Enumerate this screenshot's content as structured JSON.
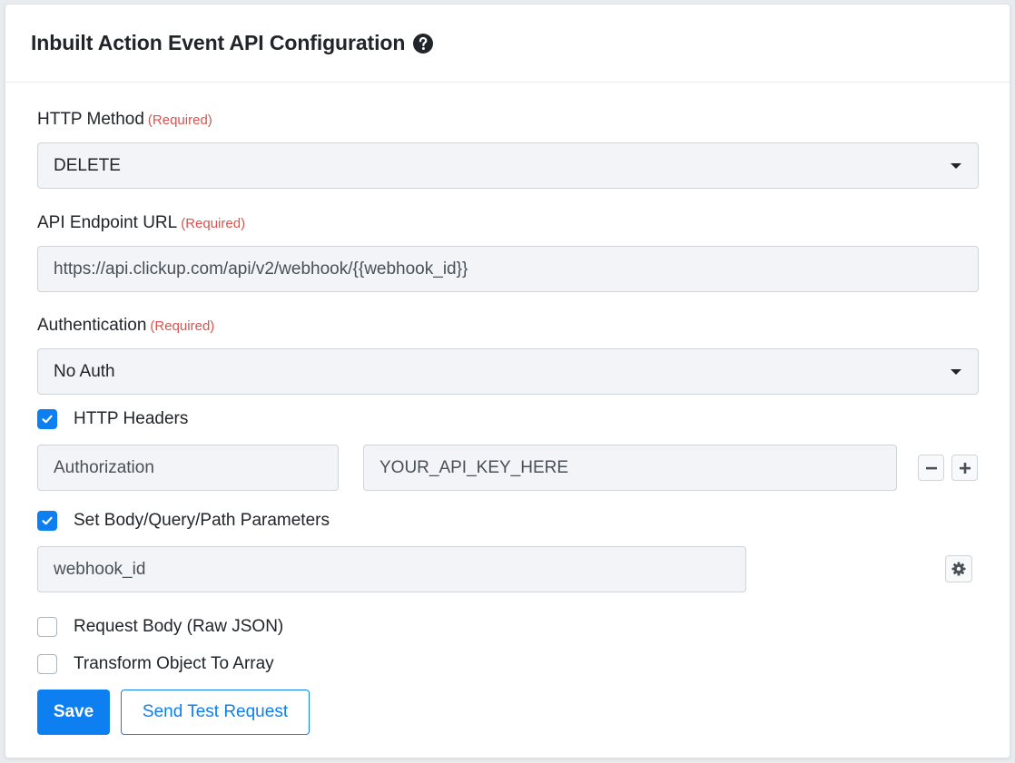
{
  "header": {
    "title": "Inbuilt Action Event API Configuration",
    "help_icon": "question-circle-icon"
  },
  "fields": {
    "http_method": {
      "label": "HTTP Method",
      "required": "(Required)",
      "value": "DELETE"
    },
    "endpoint": {
      "label": "API Endpoint URL",
      "required": "(Required)",
      "value": "https://api.clickup.com/api/v2/webhook/{{webhook_id}}"
    },
    "authentication": {
      "label": "Authentication",
      "required": "(Required)",
      "value": "No Auth"
    }
  },
  "http_headers": {
    "checked": true,
    "label": "HTTP Headers",
    "rows": [
      {
        "key": "Authorization",
        "value": "YOUR_API_KEY_HERE"
      }
    ],
    "remove_icon": "minus-icon",
    "add_icon": "plus-icon"
  },
  "params": {
    "checked": true,
    "label": "Set Body/Query/Path Parameters",
    "rows": [
      {
        "name": "webhook_id"
      }
    ],
    "settings_icon": "gear-icon"
  },
  "options": [
    {
      "label": "Request Body (Raw JSON)",
      "checked": false
    },
    {
      "label": "Transform Object To Array",
      "checked": false
    }
  ],
  "actions": {
    "save_label": "Save",
    "test_label": "Send Test Request"
  },
  "colors": {
    "primary": "#0d7ff0",
    "required": "#d9534f",
    "input_bg": "#f2f4f7"
  }
}
